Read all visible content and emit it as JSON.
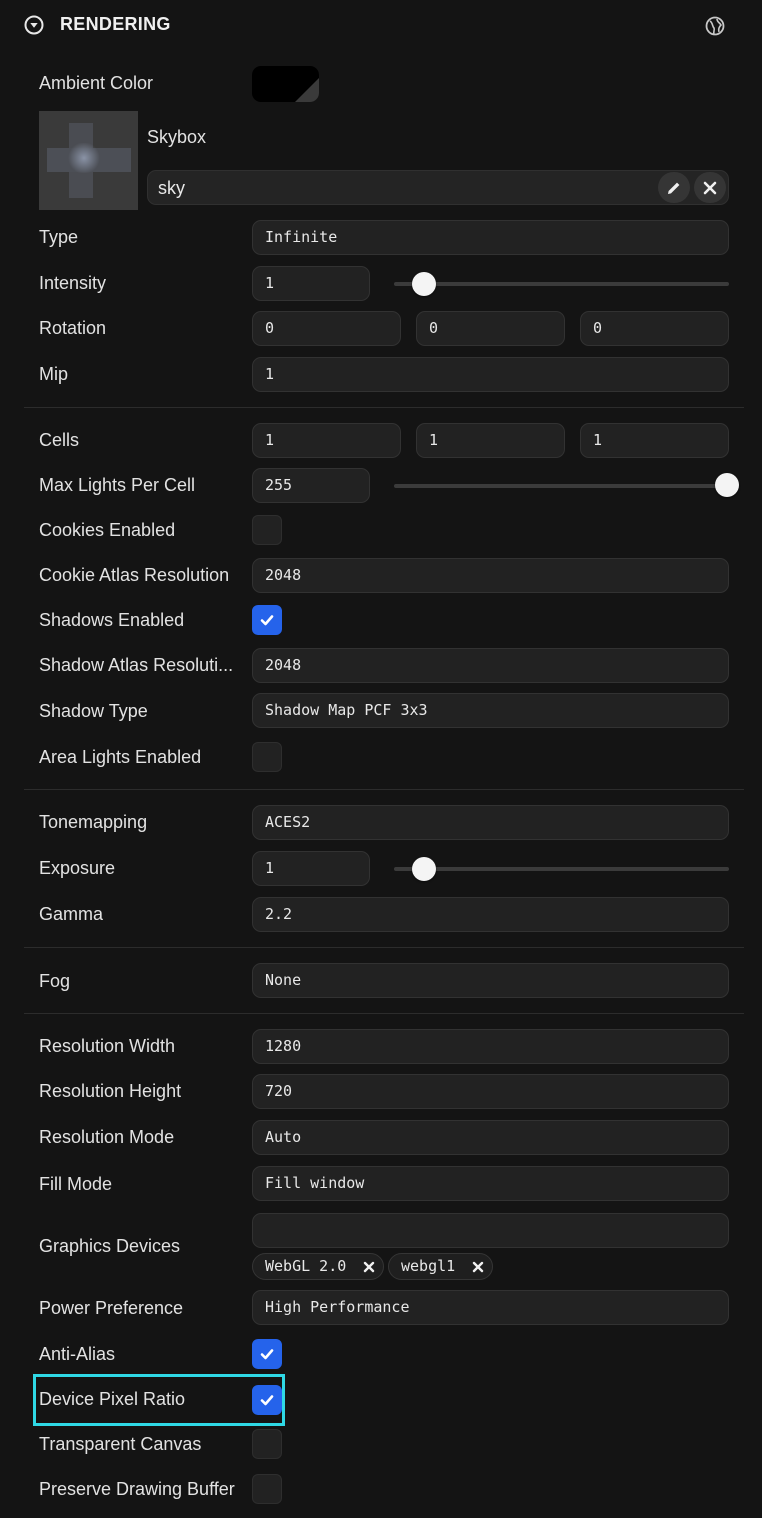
{
  "panel": {
    "title": "RENDERING",
    "collapse_icon": "chevron-down-circle-icon",
    "globe_icon": "globe-icon"
  },
  "ambient": {
    "label": "Ambient Color",
    "color": "#000000"
  },
  "skybox": {
    "label": "Skybox",
    "value": "sky",
    "edit_icon": "pencil-icon",
    "clear_icon": "close-icon"
  },
  "type": {
    "label": "Type",
    "value": "Infinite"
  },
  "intensity": {
    "label": "Intensity",
    "value": "1",
    "slider_fraction": 0.09
  },
  "rotation": {
    "label": "Rotation",
    "x": "0",
    "y": "0",
    "z": "0"
  },
  "mip": {
    "label": "Mip",
    "value": "1"
  },
  "cells": {
    "label": "Cells",
    "x": "1",
    "y": "1",
    "z": "1"
  },
  "max_lights": {
    "label": "Max Lights Per Cell",
    "value": "255",
    "slider_fraction": 1.0
  },
  "cookies_enabled": {
    "label": "Cookies Enabled",
    "checked": false
  },
  "cookie_atlas": {
    "label": "Cookie Atlas Resolution",
    "value": "2048"
  },
  "shadows_enabled": {
    "label": "Shadows Enabled",
    "checked": true
  },
  "shadow_atlas": {
    "label": "Shadow Atlas Resoluti...",
    "value": "2048"
  },
  "shadow_type": {
    "label": "Shadow Type",
    "value": "Shadow Map PCF 3x3"
  },
  "area_lights": {
    "label": "Area Lights Enabled",
    "checked": false
  },
  "tonemapping": {
    "label": "Tonemapping",
    "value": "ACES2"
  },
  "exposure": {
    "label": "Exposure",
    "value": "1",
    "slider_fraction": 0.09
  },
  "gamma": {
    "label": "Gamma",
    "value": "2.2"
  },
  "fog": {
    "label": "Fog",
    "value": "None"
  },
  "res_width": {
    "label": "Resolution Width",
    "value": "1280"
  },
  "res_height": {
    "label": "Resolution Height",
    "value": "720"
  },
  "res_mode": {
    "label": "Resolution Mode",
    "value": "Auto"
  },
  "fill_mode": {
    "label": "Fill Mode",
    "value": "Fill window"
  },
  "graphics_devices": {
    "label": "Graphics Devices",
    "input_value": "",
    "chips": [
      "WebGL 2.0",
      "webgl1"
    ]
  },
  "power": {
    "label": "Power Preference",
    "value": "High Performance"
  },
  "anti_alias": {
    "label": "Anti-Alias",
    "checked": true
  },
  "device_pixel_ratio": {
    "label": "Device Pixel Ratio",
    "checked": true
  },
  "transparent_canvas": {
    "label": "Transparent Canvas",
    "checked": false
  },
  "preserve_buffer": {
    "label": "Preserve Drawing Buffer",
    "checked": false
  },
  "colors": {
    "accent": "#2563eb",
    "highlight": "#2fd9e6",
    "background": "#141414"
  }
}
